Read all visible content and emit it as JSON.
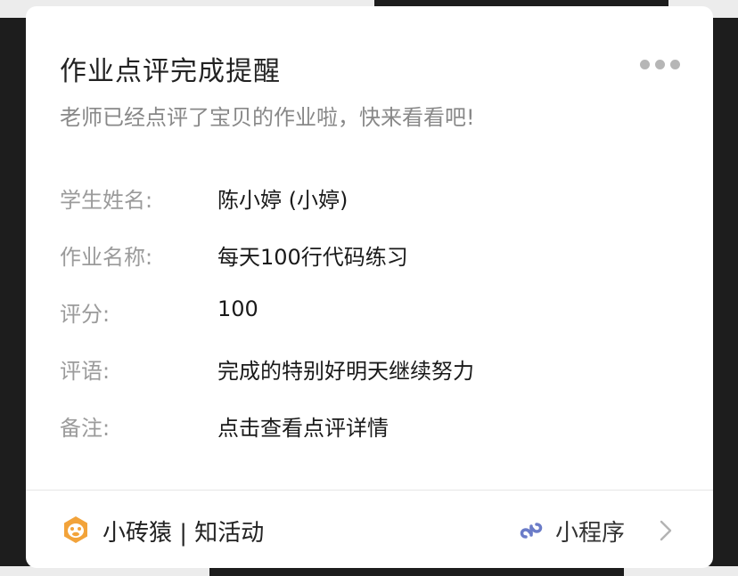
{
  "card": {
    "title": "作业点评完成提醒",
    "subtitle": "老师已经点评了宝贝的作业啦，快来看看吧!"
  },
  "details": [
    {
      "label": "学生姓名:",
      "value": "陈小婷 (小婷)"
    },
    {
      "label": "作业名称:",
      "value": "每天100行代码练习"
    },
    {
      "label": "评分:",
      "value": "100"
    },
    {
      "label": "评语:",
      "value": "完成的特别好明天继续努力"
    },
    {
      "label": "备注:",
      "value": "点击查看点评详情"
    }
  ],
  "footer": {
    "app_name": "小砖猿 | 知活动",
    "mini_program_label": "小程序"
  },
  "icons": {
    "more": "more-dots-icon",
    "logo": "monkey-logo-icon",
    "mini_program": "mini-program-link-icon",
    "chevron": "chevron-right-icon"
  },
  "colors": {
    "logo_orange": "#F2A33A",
    "mini_program_blue": "#6B7CC8",
    "muted_text": "#9B9B9B"
  }
}
